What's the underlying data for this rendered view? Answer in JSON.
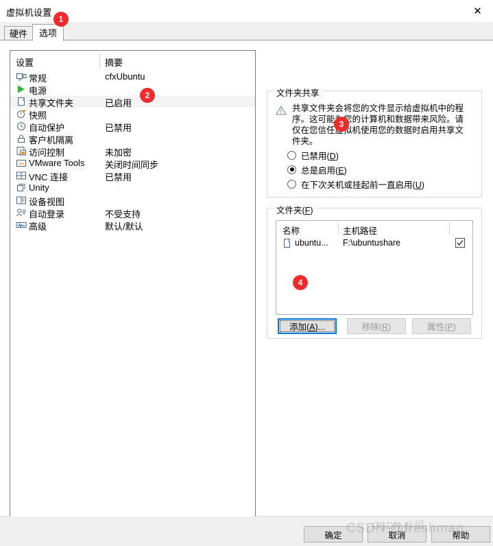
{
  "window": {
    "title": "虚拟机设置",
    "close_icon": "close-icon"
  },
  "tabs": [
    {
      "label": "硬件",
      "active": false
    },
    {
      "label": "选项",
      "active": true
    }
  ],
  "settings_list": {
    "columns": [
      "设置",
      "摘要"
    ],
    "rows": [
      {
        "icon": "monitor-icon",
        "name": "常规",
        "summary": "cfxUbuntu",
        "selected": false
      },
      {
        "icon": "power-play-icon",
        "name": "电源",
        "summary": "",
        "selected": false
      },
      {
        "icon": "shared-folder-icon",
        "name": "共享文件夹",
        "summary": "已启用",
        "selected": true
      },
      {
        "icon": "snapshot-clock-icon",
        "name": "快照",
        "summary": "",
        "selected": false
      },
      {
        "icon": "autoprotect-icon",
        "name": "自动保护",
        "summary": "已禁用",
        "selected": false
      },
      {
        "icon": "lock-icon",
        "name": "客户机隔离",
        "summary": "",
        "selected": false
      },
      {
        "icon": "access-control-icon",
        "name": "访问控制",
        "summary": "未加密",
        "selected": false
      },
      {
        "icon": "vmware-tools-icon",
        "name": "VMware Tools",
        "summary": "关闭时间同步",
        "selected": false
      },
      {
        "icon": "vnc-icon",
        "name": "VNC 连接",
        "summary": "已禁用",
        "selected": false
      },
      {
        "icon": "unity-icon",
        "name": "Unity",
        "summary": "",
        "selected": false
      },
      {
        "icon": "device-view-icon",
        "name": "设备视图",
        "summary": "",
        "selected": false
      },
      {
        "icon": "auto-login-icon",
        "name": "自动登录",
        "summary": "不受支持",
        "selected": false
      },
      {
        "icon": "advanced-icon",
        "name": "高级",
        "summary": "默认/默认",
        "selected": false
      }
    ]
  },
  "folder_sharing": {
    "legend": "文件夹共享",
    "warning_icon": "warning-triangle-icon",
    "warning_text": "共享文件夹会将您的文件显示给虚拟机中的程序。这可能为您的计算机和数据带来风险。请仅在您信任虚拟机使用您的数据时启用共享文件夹。",
    "options": [
      {
        "label": "已禁用",
        "mnemonic": "D",
        "selected": false
      },
      {
        "label": "总是启用",
        "mnemonic": "E",
        "selected": true
      },
      {
        "label": "在下次关机或挂起前一直启用",
        "mnemonic": "U",
        "selected": false
      }
    ]
  },
  "folders": {
    "legend": "文件夹",
    "legend_mnemonic": "F",
    "columns": [
      "名称",
      "主机路径"
    ],
    "rows": [
      {
        "icon": "folder-icon",
        "name": "ubuntu...",
        "host_path": "F:\\ubuntushare",
        "enabled": true
      }
    ],
    "buttons": [
      {
        "label": "添加",
        "mnemonic": "A",
        "suffix": "...",
        "state": "focused"
      },
      {
        "label": "移除",
        "mnemonic": "R",
        "suffix": "",
        "state": "disabled"
      },
      {
        "label": "属性",
        "mnemonic": "P",
        "suffix": "",
        "state": "disabled"
      }
    ]
  },
  "footer": {
    "ok": "确定",
    "cancel": "取消",
    "help": "帮助"
  },
  "badges": [
    {
      "number": "1"
    },
    {
      "number": "2"
    },
    {
      "number": "3"
    },
    {
      "number": "4"
    }
  ],
  "watermark": {
    "line1": "CSDN @freshman",
    "line2": "CSDN @恒"
  },
  "colors": {
    "badge": "#ef2b2b",
    "focus": "#0078d7",
    "selected_row": "#f3f3f3"
  }
}
